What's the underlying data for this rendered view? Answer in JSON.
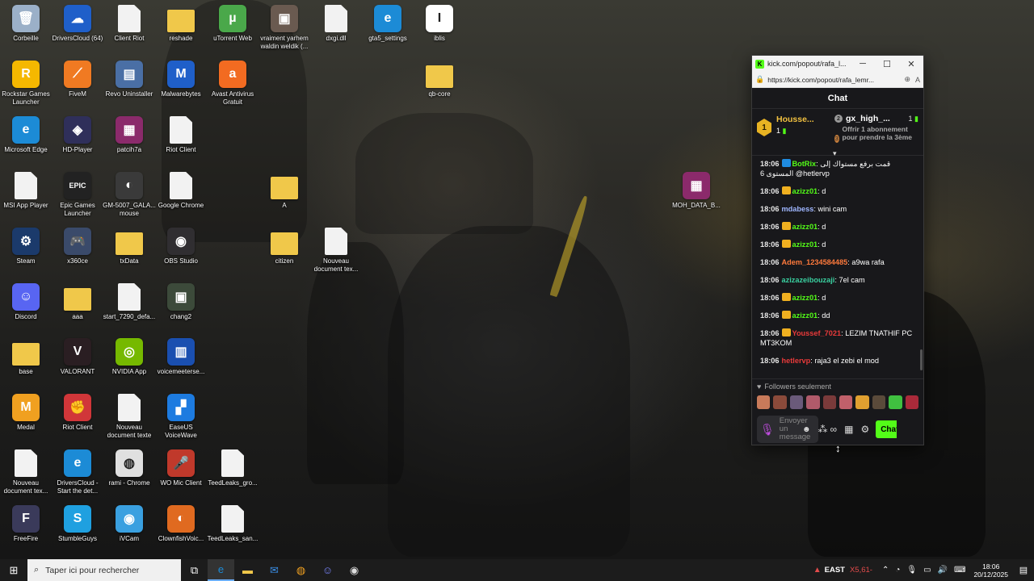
{
  "desktop": {
    "icons": [
      {
        "label": "Corbeille",
        "icon": "recycle-bin-icon",
        "type": "app",
        "color": "#9bb0c8",
        "glyph": "🗑"
      },
      {
        "label": "DriversCloud (64)",
        "icon": "driverscloud-icon",
        "type": "app",
        "color": "#1f5fc9",
        "glyph": "☁"
      },
      {
        "label": "Client Riot",
        "icon": "file-icon",
        "type": "file",
        "color": "#f2f2f2",
        "glyph": ""
      },
      {
        "label": "reshade",
        "icon": "folder-icon",
        "type": "folder",
        "color": "#f0c84a",
        "glyph": ""
      },
      {
        "label": "uTorrent Web",
        "icon": "utorrent-icon",
        "type": "app",
        "color": "#4aa84a",
        "glyph": "µ"
      },
      {
        "label": "vraiment yarhem waldin weldik (...",
        "icon": "image-thumb-icon",
        "type": "app",
        "color": "#6a5a50",
        "glyph": "▣"
      },
      {
        "label": "dxgi.dll",
        "icon": "dll-file-icon",
        "type": "file",
        "color": "#f2f2f2",
        "glyph": ""
      },
      {
        "label": "gta5_settings",
        "icon": "edge-shortcut-icon",
        "type": "app",
        "color": "#1c8bd6",
        "glyph": "e"
      },
      {
        "label": "iblis",
        "icon": "iblis-icon",
        "type": "app",
        "color": "#ffffff",
        "glyph": "I"
      },
      {
        "label": "Rockstar Games Launcher",
        "icon": "rockstar-icon",
        "type": "app",
        "color": "#f5b800",
        "glyph": "R"
      },
      {
        "label": "FiveM",
        "icon": "fivem-icon",
        "type": "app",
        "color": "#f07a22",
        "glyph": "⟋"
      },
      {
        "label": "Revo Uninstaller",
        "icon": "revo-icon",
        "type": "app",
        "color": "#4a6fa5",
        "glyph": "▤"
      },
      {
        "label": "Malwarebytes",
        "icon": "malwarebytes-icon",
        "type": "app",
        "color": "#1f5fc9",
        "glyph": "M"
      },
      {
        "label": "Avast Antivirus Gratuit",
        "icon": "avast-icon",
        "type": "app",
        "color": "#f26b21",
        "glyph": "a"
      },
      {
        "label": "qb-core",
        "icon": "folder-icon",
        "type": "folder",
        "color": "#f0c84a",
        "glyph": ""
      },
      {
        "label": "Microsoft Edge",
        "icon": "edge-icon",
        "type": "app",
        "color": "#1c8bd6",
        "glyph": "e"
      },
      {
        "label": "HD-Player",
        "icon": "hdplayer-icon",
        "type": "app",
        "color": "#2f2f5a",
        "glyph": "◈"
      },
      {
        "label": "patcih7a",
        "icon": "winrar-icon",
        "type": "app",
        "color": "#8b2a6b",
        "glyph": "▦"
      },
      {
        "label": "Riot Client",
        "icon": "file-icon",
        "type": "file",
        "color": "#f2f2f2",
        "glyph": ""
      },
      {
        "label": "MSI App Player",
        "icon": "file-icon",
        "type": "file",
        "color": "#f2f2f2",
        "glyph": ""
      },
      {
        "label": "Epic Games Launcher",
        "icon": "epic-games-icon",
        "type": "app",
        "color": "#222222",
        "glyph": "EPIC"
      },
      {
        "label": "GM-5007_GALA... mouse",
        "icon": "mouse-app-icon",
        "type": "app",
        "color": "#3a3a3a",
        "glyph": "◐"
      },
      {
        "label": "Google Chrome",
        "icon": "file-icon",
        "type": "file",
        "color": "#f2f2f2",
        "glyph": ""
      },
      {
        "label": "A",
        "icon": "folder-icon",
        "type": "folder",
        "color": "#f0c84a",
        "glyph": ""
      },
      {
        "label": "MOH_DATA_B...",
        "icon": "winrar-icon",
        "type": "app",
        "color": "#8b2a6b",
        "glyph": "▦"
      },
      {
        "label": "Steam",
        "icon": "steam-icon",
        "type": "app",
        "color": "#1b3a6b",
        "glyph": "⚙"
      },
      {
        "label": "x360ce",
        "icon": "gamepad-icon",
        "type": "app",
        "color": "#3a4a6a",
        "glyph": "🎮"
      },
      {
        "label": "txData",
        "icon": "folder-icon",
        "type": "folder",
        "color": "#f0c84a",
        "glyph": ""
      },
      {
        "label": "OBS Studio",
        "icon": "obs-icon",
        "type": "app",
        "color": "#302e31",
        "glyph": "◉"
      },
      {
        "label": "citizen",
        "icon": "folder-icon",
        "type": "folder",
        "color": "#f0c84a",
        "glyph": ""
      },
      {
        "label": "Nouveau document tex...",
        "icon": "text-file-icon",
        "type": "file",
        "color": "#f2f2f2",
        "glyph": ""
      },
      {
        "label": "Discord",
        "icon": "discord-icon",
        "type": "app",
        "color": "#5865f2",
        "glyph": "☺"
      },
      {
        "label": "aaa",
        "icon": "folder-icon",
        "type": "folder",
        "color": "#f0c84a",
        "glyph": ""
      },
      {
        "label": "start_7290_defa...",
        "icon": "image-file-icon",
        "type": "file",
        "color": "#f2f2f2",
        "glyph": ""
      },
      {
        "label": "chang2",
        "icon": "image-thumb-icon",
        "type": "app",
        "color": "#3c4a3a",
        "glyph": "▣"
      },
      {
        "label": "base",
        "icon": "folder-icon",
        "type": "folder",
        "color": "#f0c84a",
        "glyph": ""
      },
      {
        "label": "VALORANT",
        "icon": "valorant-icon",
        "type": "app",
        "color": "#2a1e22",
        "glyph": "V"
      },
      {
        "label": "NVIDIA App",
        "icon": "nvidia-icon",
        "type": "app",
        "color": "#76b900",
        "glyph": "◎"
      },
      {
        "label": "voicemeeterse...",
        "icon": "voicemeeter-icon",
        "type": "app",
        "color": "#1a4fb0",
        "glyph": "▥"
      },
      {
        "label": "Medal",
        "icon": "medal-icon",
        "type": "app",
        "color": "#f0a020",
        "glyph": "M"
      },
      {
        "label": "Riot Client",
        "icon": "riot-icon",
        "type": "app",
        "color": "#d13639",
        "glyph": "✊"
      },
      {
        "label": "Nouveau document texte",
        "icon": "text-file-icon",
        "type": "file",
        "color": "#f2f2f2",
        "glyph": ""
      },
      {
        "label": "EaseUS VoiceWave",
        "icon": "easeus-icon",
        "type": "app",
        "color": "#1d7be0",
        "glyph": "▞"
      },
      {
        "label": "Nouveau document tex...",
        "icon": "text-file-icon",
        "type": "file",
        "color": "#f2f2f2",
        "glyph": ""
      },
      {
        "label": "DriversCloud - Start the det...",
        "icon": "edge-shortcut-icon",
        "type": "app",
        "color": "#1c8bd6",
        "glyph": "e"
      },
      {
        "label": "rami - Chrome",
        "icon": "chrome-icon",
        "type": "app",
        "color": "#e0e0e0",
        "glyph": "◍"
      },
      {
        "label": "WO Mic Client",
        "icon": "wo-mic-icon",
        "type": "app",
        "color": "#c0392b",
        "glyph": "🎤"
      },
      {
        "label": "TeedLeaks_gro...",
        "icon": "text-file-icon",
        "type": "file",
        "color": "#f2f2f2",
        "glyph": ""
      },
      {
        "label": "FreeFire",
        "icon": "freefire-icon",
        "type": "app",
        "color": "#3a3a5a",
        "glyph": "F"
      },
      {
        "label": "StumbleGuys",
        "icon": "stumbleguys-icon",
        "type": "app",
        "color": "#1fa0e0",
        "glyph": "S"
      },
      {
        "label": "iVCam",
        "icon": "ivcam-icon",
        "type": "app",
        "color": "#3aa0e0",
        "glyph": "◉"
      },
      {
        "label": "ClownfishVoic...",
        "icon": "clownfish-icon",
        "type": "app",
        "color": "#e06a20",
        "glyph": "◐"
      },
      {
        "label": "TeedLeaks_san...",
        "icon": "text-file-icon",
        "type": "file",
        "color": "#f2f2f2",
        "glyph": ""
      }
    ]
  },
  "popout": {
    "title": "kick.com/popout/rafa_l...",
    "url": "https://kick.com/popout/rafa_lemr...",
    "chat_header": "Chat",
    "pinned": {
      "rank": "1",
      "user": "Housse...",
      "count": "1",
      "top_user": "gx_high_...",
      "top_count": "1",
      "offer_text": "Offrir 1 abonnement pour prendre la 3ème",
      "medal2": "2",
      "medal3": "3"
    },
    "messages": [
      {
        "time": "18:06",
        "user": "BotRix",
        "user_color": "#53fc18",
        "badge_color": "#1f8be0",
        "text": "قمت برفع مستواك إلى المستوى 6 @hetlervp"
      },
      {
        "time": "18:06",
        "user": "azizz01",
        "user_color": "#53fc18",
        "badge_color": "#f0b020",
        "text": "d"
      },
      {
        "time": "18:06",
        "user": "mdabess",
        "user_color": "#9fb6ff",
        "badge_color": "",
        "text": "wini cam"
      },
      {
        "time": "18:06",
        "user": "azizz01",
        "user_color": "#53fc18",
        "badge_color": "#f0b020",
        "text": "d"
      },
      {
        "time": "18:06",
        "user": "azizz01",
        "user_color": "#53fc18",
        "badge_color": "#f0b020",
        "text": "d"
      },
      {
        "time": "18:06",
        "user": "Adem_1234584485",
        "user_color": "#ff7a3c",
        "badge_color": "",
        "text": "a9wa rafa"
      },
      {
        "time": "18:06",
        "user": "azizazeibouzaji",
        "user_color": "#3ad0a0",
        "badge_color": "",
        "text": "7el cam"
      },
      {
        "time": "18:06",
        "user": "azizz01",
        "user_color": "#53fc18",
        "badge_color": "#f0b020",
        "text": "d"
      },
      {
        "time": "18:06",
        "user": "azizz01",
        "user_color": "#53fc18",
        "badge_color": "#f0b020",
        "text": "dd"
      },
      {
        "time": "18:06",
        "user": "Youssef_7021",
        "user_color": "#e83a3a",
        "badge_color": "#f0b020",
        "text": "LEZIM TNATHIF PC MT3KOM"
      },
      {
        "time": "18:06",
        "user": "hetlervp",
        "user_color": "#e83a3a",
        "badge_color": "",
        "text": "raja3 el zebi el mod"
      }
    ],
    "followers_label": "Followers seulement",
    "emote_colors": [
      "#c87a5a",
      "#8a4a3a",
      "#6a5a7a",
      "#b05a6a",
      "#7a3a3a",
      "#c0606a",
      "#e0a030",
      "#5a4a3a",
      "#40c040",
      "#aa2a3a"
    ],
    "input_placeholder": "Envoyer un message",
    "send_label": "Chat"
  },
  "taskbar": {
    "search_placeholder": "Taper ici pour rechercher",
    "apps": [
      {
        "name": "task-view-icon",
        "glyph": "⧉",
        "color": "#ffffff",
        "active": false
      },
      {
        "name": "edge-taskbar-icon",
        "glyph": "e",
        "color": "#1c8bd6",
        "active": true
      },
      {
        "name": "file-explorer-icon",
        "glyph": "▬",
        "color": "#f0c84a",
        "active": false
      },
      {
        "name": "outlook-icon",
        "glyph": "✉",
        "color": "#3a8ee6",
        "active": false
      },
      {
        "name": "chrome-taskbar-icon",
        "glyph": "◍",
        "color": "#f0a020",
        "active": false
      },
      {
        "name": "discord-taskbar-icon",
        "glyph": "☺",
        "color": "#7a86ff",
        "active": false
      },
      {
        "name": "obs-taskbar-icon",
        "glyph": "◉",
        "color": "#dddddd",
        "active": false
      }
    ],
    "market": "EAST",
    "market_change": "X5,61-",
    "time": "18:06",
    "date": "20/12/2025"
  }
}
